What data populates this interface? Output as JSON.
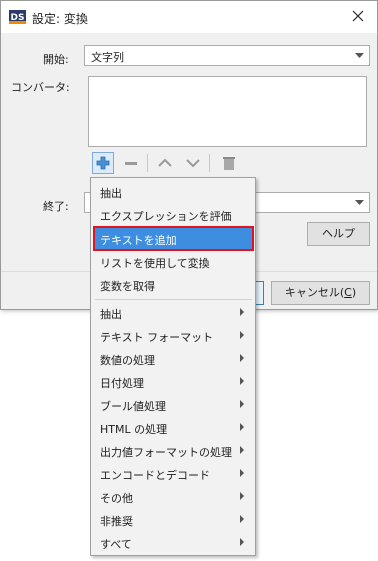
{
  "titlebar": {
    "app_icon_text": "DS",
    "title": "設定: 変換"
  },
  "form": {
    "start_label": "開始:",
    "start_value": "文字列",
    "converter_label": "コンバータ:",
    "end_label": "終了:",
    "end_value": ""
  },
  "buttons": {
    "help": "ヘルプ",
    "ok": "",
    "cancel_prefix": "キャンセル(",
    "cancel_mnemonic": "C",
    "cancel_suffix": ")"
  },
  "menu": {
    "items": [
      {
        "label": "抽出"
      },
      {
        "label": "エクスプレッションを評価"
      },
      {
        "label": "テキストを追加",
        "selected": true
      },
      {
        "label": "リストを使用して変換"
      },
      {
        "label": "変数を取得"
      }
    ],
    "submenus": [
      {
        "label": "抽出"
      },
      {
        "label": "テキスト フォーマット"
      },
      {
        "label": "数値の処理"
      },
      {
        "label": "日付処理"
      },
      {
        "label": "ブール値処理"
      },
      {
        "label": "HTML の処理"
      },
      {
        "label": "出力値フォーマットの処理"
      },
      {
        "label": "エンコードとデコード"
      },
      {
        "label": "その他"
      },
      {
        "label": "非推奨"
      },
      {
        "label": "すべて"
      }
    ]
  },
  "colors": {
    "accent": "#3d8ee0",
    "highlight_border": "#e3121f",
    "logo_orange": "#f08c00",
    "logo_navy": "#2a3a6b"
  }
}
